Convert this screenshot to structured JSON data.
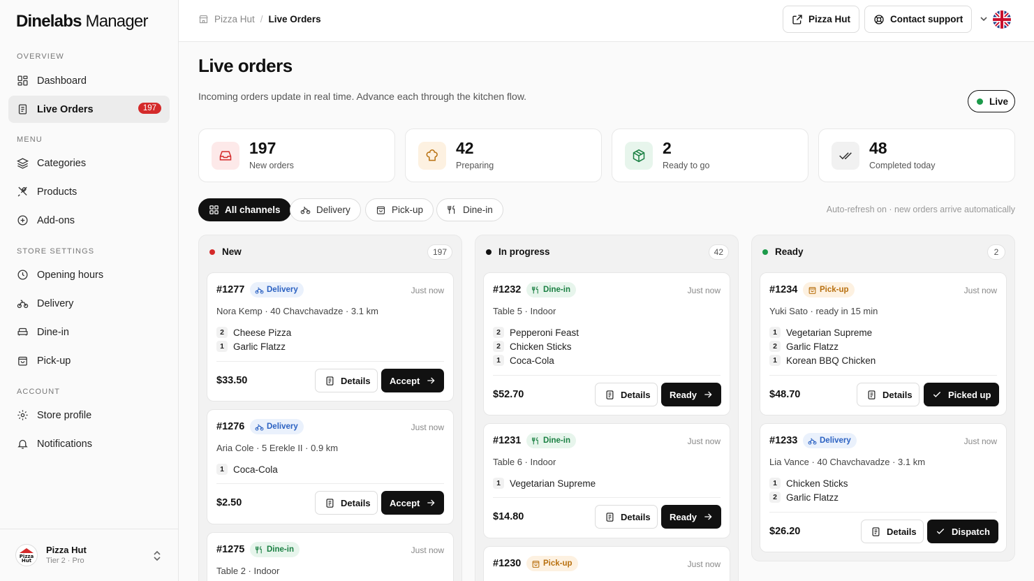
{
  "app": {
    "brand_bold": "Dinelabs",
    "brand_light": " Manager"
  },
  "sidebar": {
    "sections": {
      "overview": "OVERVIEW",
      "menu": "MENU",
      "store_settings": "STORE SETTINGS",
      "account": "ACCOUNT"
    },
    "items": [
      {
        "label": "Dashboard",
        "icon": "dashboard-icon"
      },
      {
        "label": "Live Orders",
        "icon": "orders-icon",
        "badge": "197",
        "active": true
      },
      {
        "label": "Categories",
        "icon": "layers-icon"
      },
      {
        "label": "Products",
        "icon": "utensils-icon"
      },
      {
        "label": "Add-ons",
        "icon": "plus-circle-icon"
      },
      {
        "label": "Opening hours",
        "icon": "clock-icon"
      },
      {
        "label": "Delivery",
        "icon": "bike-icon"
      },
      {
        "label": "Dine-in",
        "icon": "sofa-icon"
      },
      {
        "label": "Pick-up",
        "icon": "bag-icon"
      },
      {
        "label": "Store profile",
        "icon": "gear-icon"
      },
      {
        "label": "Notifications",
        "icon": "bell-icon"
      }
    ],
    "store": {
      "name": "Pizza Hut",
      "tier": "Tier 2 · Pro",
      "logo_text": "Pizza Hut"
    }
  },
  "topbar": {
    "breadcrumb": [
      "Pizza Hut",
      "Live Orders"
    ],
    "store_button": "Pizza Hut",
    "support_button": "Contact support"
  },
  "page": {
    "title": "Live orders",
    "subtitle": "Incoming orders update in real time. Advance each through the kitchen flow.",
    "live_label": "Live",
    "auto_refresh": "Auto-refresh on · new orders arrive automatically"
  },
  "stats": [
    {
      "value": "197",
      "label": "New orders",
      "color": "#d42a2a"
    },
    {
      "value": "42",
      "label": "Preparing",
      "color": "#b8700f"
    },
    {
      "value": "2",
      "label": "Ready to go",
      "color": "#1b8043"
    },
    {
      "value": "48",
      "label": "Completed today",
      "color": "#333333"
    }
  ],
  "filters": [
    "All channels",
    "Delivery",
    "Pick-up",
    "Dine-in"
  ],
  "columns": [
    {
      "title": "New",
      "count": "197",
      "dot": "#d42a2a",
      "cards": [
        {
          "id": "#1277",
          "tag": "Delivery",
          "time": "Just now",
          "info": "Nora Kemp · 40 Chavchavadze · 3.1 km",
          "items": [
            {
              "q": "2",
              "name": "Cheese Pizza"
            },
            {
              "q": "1",
              "name": "Garlic Flatzz"
            }
          ],
          "price": "$33.50",
          "details": "Details",
          "action": "Accept"
        },
        {
          "id": "#1276",
          "tag": "Delivery",
          "time": "Just now",
          "info": "Aria Cole · 5 Erekle II · 0.9 km",
          "items": [
            {
              "q": "1",
              "name": "Coca-Cola"
            }
          ],
          "price": "$2.50",
          "details": "Details",
          "action": "Accept"
        },
        {
          "id": "#1275",
          "tag": "Dine-in",
          "time": "Just now",
          "info": "Table 2 · Indoor"
        }
      ]
    },
    {
      "title": "In progress",
      "count": "42",
      "dot": "#111111",
      "cards": [
        {
          "id": "#1232",
          "tag": "Dine-in",
          "time": "Just now",
          "info": "Table 5 · Indoor",
          "items": [
            {
              "q": "2",
              "name": "Pepperoni Feast"
            },
            {
              "q": "2",
              "name": "Chicken Sticks"
            },
            {
              "q": "1",
              "name": "Coca-Cola"
            }
          ],
          "price": "$52.70",
          "details": "Details",
          "action": "Ready"
        },
        {
          "id": "#1231",
          "tag": "Dine-in",
          "time": "Just now",
          "info": "Table 6 · Indoor",
          "items": [
            {
              "q": "1",
              "name": "Vegetarian Supreme"
            }
          ],
          "price": "$14.80",
          "details": "Details",
          "action": "Ready"
        },
        {
          "id": "#1230",
          "tag": "Pick-up",
          "time": "Just now"
        }
      ]
    },
    {
      "title": "Ready",
      "count": "2",
      "dot": "#1c9a4a",
      "cards": [
        {
          "id": "#1234",
          "tag": "Pick-up",
          "time": "Just now",
          "info": "Yuki Sato · ready in 15 min",
          "items": [
            {
              "q": "1",
              "name": "Vegetarian Supreme"
            },
            {
              "q": "2",
              "name": "Garlic Flatzz"
            },
            {
              "q": "1",
              "name": "Korean BBQ Chicken"
            }
          ],
          "price": "$48.70",
          "details": "Details",
          "action": "Picked up"
        },
        {
          "id": "#1233",
          "tag": "Delivery",
          "time": "Just now",
          "info": "Lia Vance · 40 Chavchavadze · 3.1 km",
          "items": [
            {
              "q": "1",
              "name": "Chicken Sticks"
            },
            {
              "q": "2",
              "name": "Garlic Flatzz"
            }
          ],
          "price": "$26.20",
          "details": "Details",
          "action": "Dispatch"
        }
      ]
    }
  ]
}
